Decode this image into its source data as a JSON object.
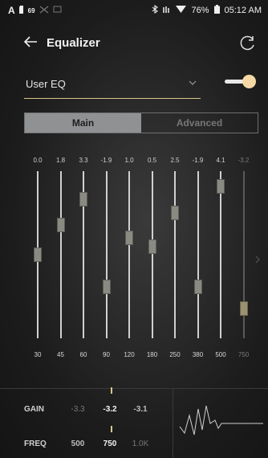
{
  "status_bar": {
    "carrier_letter": "A",
    "battery_small": "69",
    "battery_percent": "76%",
    "time": "05:12 AM",
    "left_icons": [
      "sd-card-icon",
      "usb-icon",
      "cast-icon"
    ],
    "right_icons": [
      "bluetooth-icon",
      "equalizer-status-icon",
      "wifi-icon",
      "battery-icon"
    ]
  },
  "app_bar": {
    "title": "Equalizer",
    "back_icon": "arrow-left-icon",
    "refresh_icon": "refresh-icon"
  },
  "preset": {
    "selected": "User EQ",
    "enabled": true
  },
  "tabs": [
    {
      "label": "Main",
      "active": true
    },
    {
      "label": "Advanced",
      "active": false
    }
  ],
  "bands": [
    {
      "freq": "30",
      "gain": "0.0",
      "gain_value": 0.0
    },
    {
      "freq": "45",
      "gain": "1.8",
      "gain_value": 1.8
    },
    {
      "freq": "60",
      "gain": "3.3",
      "gain_value": 3.3
    },
    {
      "freq": "90",
      "gain": "-1.9",
      "gain_value": -1.9
    },
    {
      "freq": "120",
      "gain": "1.0",
      "gain_value": 1.0
    },
    {
      "freq": "180",
      "gain": "0.5",
      "gain_value": 0.5
    },
    {
      "freq": "250",
      "gain": "2.5",
      "gain_value": 2.5
    },
    {
      "freq": "380",
      "gain": "-1.9",
      "gain_value": -1.9
    },
    {
      "freq": "500",
      "gain": "4.1",
      "gain_value": 4.1
    },
    {
      "freq": "750",
      "gain": "-3.2",
      "gain_value": -3.2
    }
  ],
  "gain_range": [
    -5,
    5
  ],
  "selected_band_index": 9,
  "bottom_panel": {
    "gain_label": "GAIN",
    "freq_label": "FREQ",
    "gain_values": [
      "-3.3",
      "-3.2",
      "-3.1"
    ],
    "freq_values": [
      "500",
      "750",
      "1.0K"
    ]
  },
  "colors": {
    "accent": "#d9c68a",
    "toggle_knob": "#f4d9a6",
    "tab_active_bg": "#8f9193"
  }
}
